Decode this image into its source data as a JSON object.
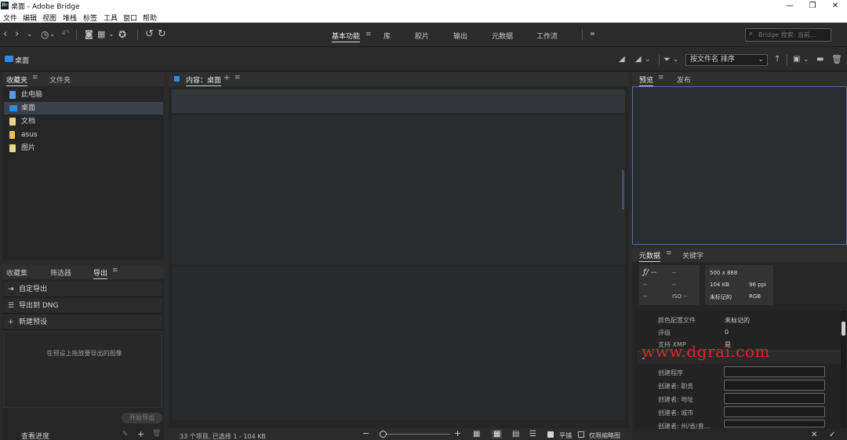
{
  "window": {
    "logo_text": "Br",
    "title": "桌面 - Adobe Bridge",
    "minimize": "—",
    "restore": "❐",
    "close": "✕"
  },
  "menu": [
    "文件",
    "编辑",
    "视图",
    "堆栈",
    "标签",
    "工具",
    "窗口",
    "帮助"
  ],
  "toolbar": {
    "workspaces": [
      "基本功能",
      "库",
      "胶片",
      "输出",
      "元数据",
      "工作流"
    ],
    "active_workspace": "基本功能",
    "more": "»",
    "search_placeholder": "Bridge 搜索: 当前..."
  },
  "pathbar": {
    "path": "桌面",
    "sort_label": "按文件名 排序",
    "sort_arrow": "⌄"
  },
  "favorites_panel": {
    "tabs": [
      "收藏夹",
      "文件夹"
    ],
    "items": [
      {
        "label": "此电脑",
        "color": "#5a9be0"
      },
      {
        "label": "桌面",
        "color": "#2f8ce6"
      },
      {
        "label": "文档",
        "color": "#e9d58a"
      },
      {
        "label": "asus",
        "color": "#e9c24a"
      },
      {
        "label": "图片",
        "color": "#e9d58a"
      }
    ]
  },
  "export_panel": {
    "tabs": [
      "收藏集",
      "筛选器",
      "导出"
    ],
    "rows": [
      "自定导出",
      "导出到 DNG",
      "新建预设"
    ],
    "drop_hint": "在预设上拖放要导出的图像",
    "start_export": "开始导出",
    "view_progress": "查看进度"
  },
  "content_panel": {
    "title": "内容：桌面",
    "plus": "+",
    "status": "33 个项目, 已选择 1 - 104 KB",
    "flat": "平铺",
    "thumbs_only": "仅限缩略图"
  },
  "preview_panel": {
    "tabs": [
      "预览",
      "发布"
    ]
  },
  "metadata_panel": {
    "tabs": [
      "元数据",
      "关键字"
    ],
    "placard": {
      "fstop": "ƒ/ --",
      "shutter": "--",
      "blank1": "--",
      "blank2": "--",
      "blank3": "--",
      "iso": "ISO --",
      "dimensions": "500 x 888",
      "size": "104 KB",
      "ppi": "96 ppi",
      "color_profile": "未标记的",
      "mode": "RGB"
    },
    "fields": [
      {
        "label": "颜色配置文件",
        "value": "未标记的"
      },
      {
        "label": "评级",
        "value": "0"
      },
      {
        "label": "支持 XMP",
        "value": "是"
      }
    ],
    "iptc_fields": [
      "创建程序",
      "创建者: 职务",
      "创建者: 地址",
      "创建者: 城市",
      "创建者: 州/省/直..."
    ],
    "cancel": "✕",
    "apply": "✓"
  },
  "watermark": "www.dgrai.com"
}
